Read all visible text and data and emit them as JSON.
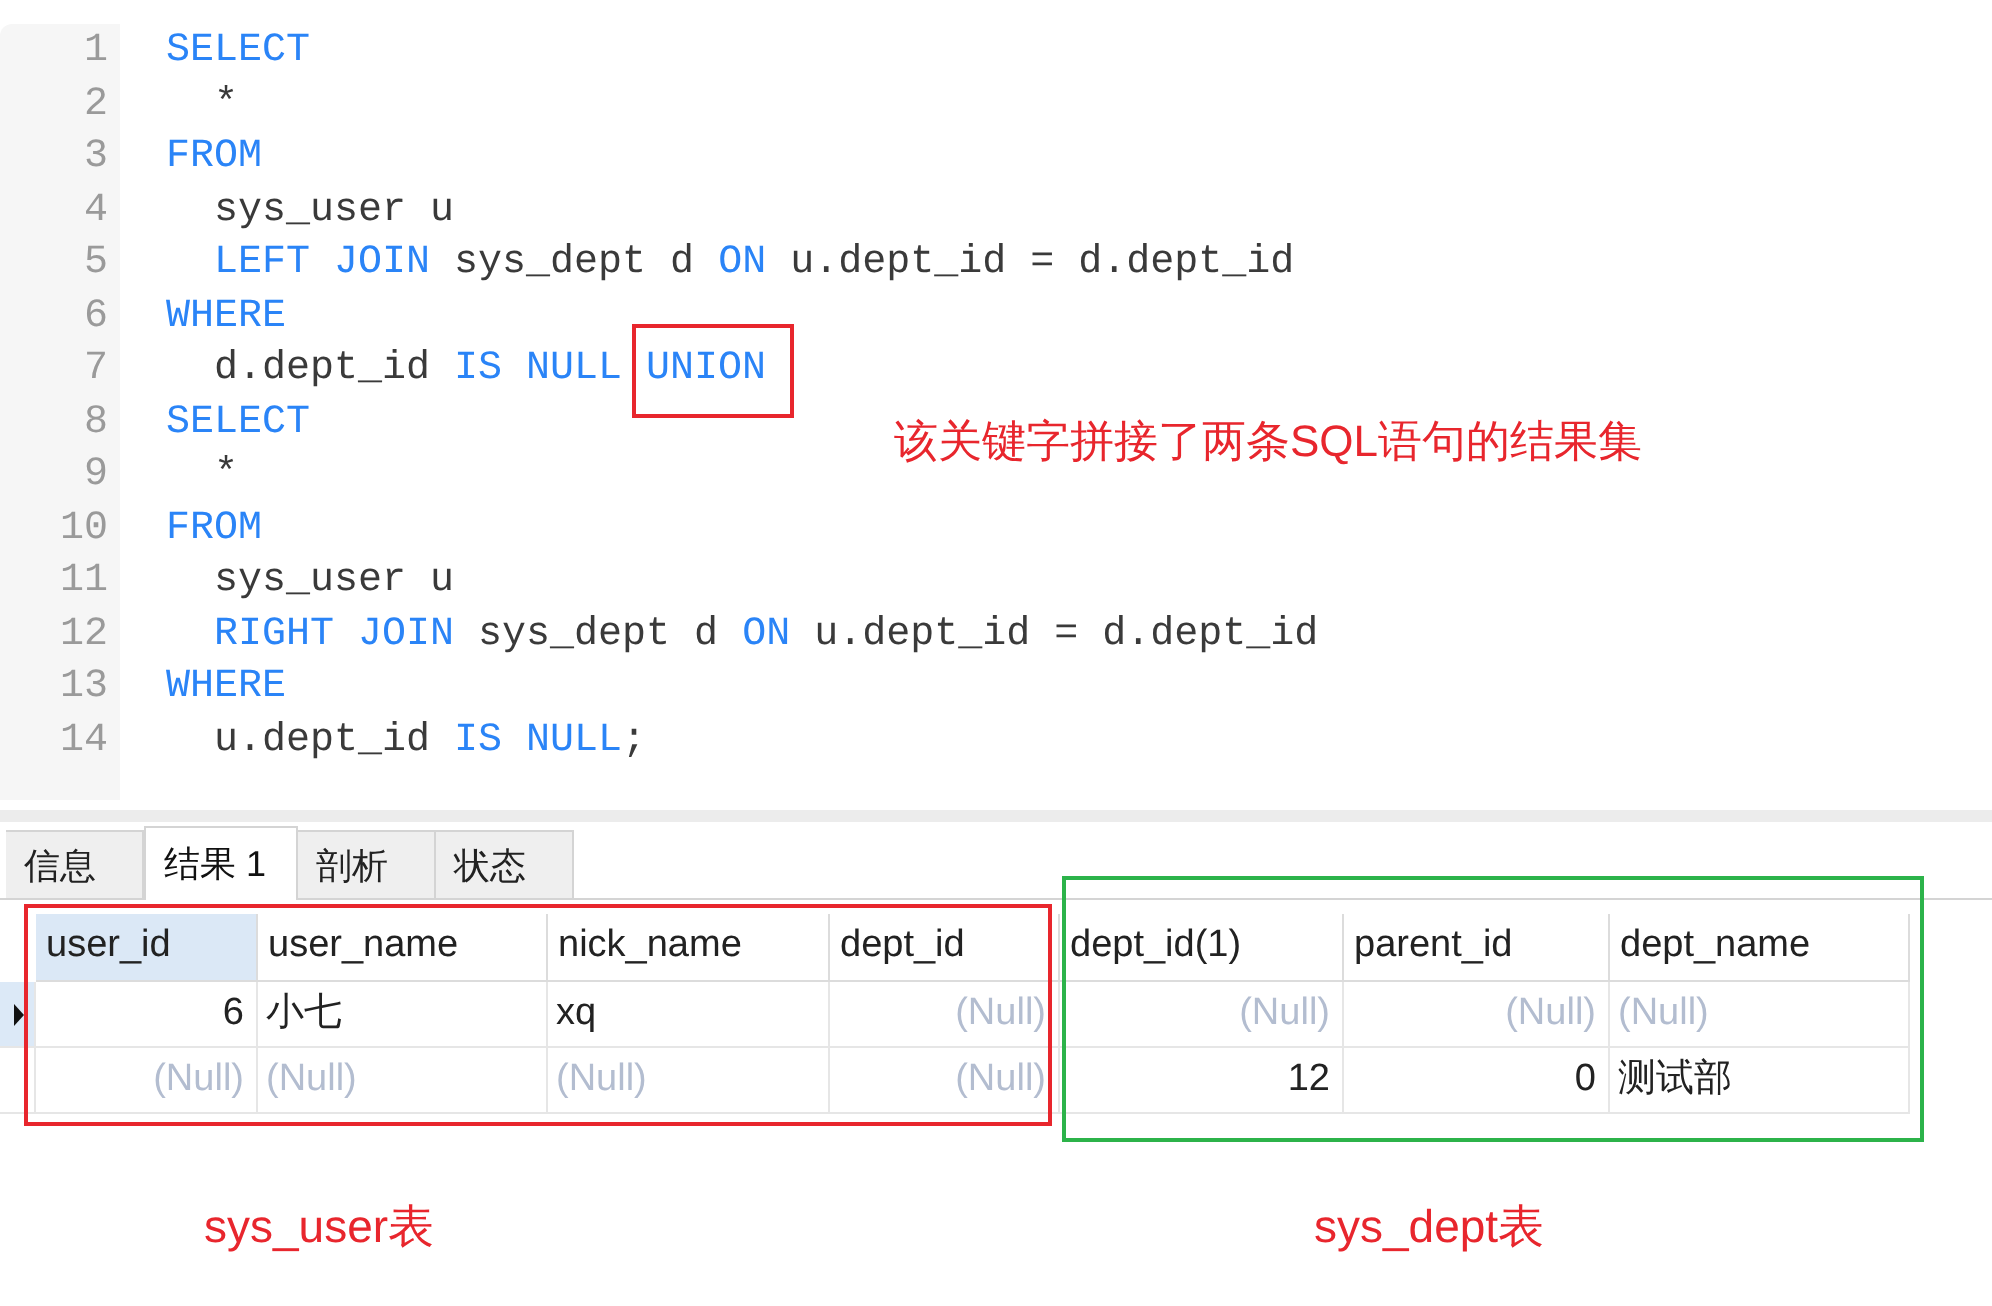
{
  "editor": {
    "lines": [
      {
        "number": "1",
        "tokens": [
          {
            "kind": "keyword",
            "text": "SELECT"
          }
        ]
      },
      {
        "number": "2",
        "tokens": [
          {
            "kind": "plain",
            "text": "  *"
          }
        ]
      },
      {
        "number": "3",
        "tokens": [
          {
            "kind": "keyword",
            "text": "FROM"
          }
        ]
      },
      {
        "number": "4",
        "tokens": [
          {
            "kind": "plain",
            "text": "  sys_user u"
          }
        ]
      },
      {
        "number": "5",
        "tokens": [
          {
            "kind": "keyword",
            "text": "  LEFT JOIN"
          },
          {
            "kind": "plain",
            "text": " sys_dept d "
          },
          {
            "kind": "keyword",
            "text": "ON"
          },
          {
            "kind": "plain",
            "text": " u.dept_id = d.dept_id"
          }
        ]
      },
      {
        "number": "6",
        "tokens": [
          {
            "kind": "keyword",
            "text": "WHERE"
          }
        ]
      },
      {
        "number": "7",
        "tokens": [
          {
            "kind": "plain",
            "text": "  d.dept_id "
          },
          {
            "kind": "keyword",
            "text": "IS NULL "
          },
          {
            "kind": "keyword",
            "text": "UNION",
            "boxed": true
          }
        ]
      },
      {
        "number": "8",
        "tokens": [
          {
            "kind": "keyword",
            "text": "SELECT"
          }
        ]
      },
      {
        "number": "9",
        "tokens": [
          {
            "kind": "plain",
            "text": "  *"
          }
        ]
      },
      {
        "number": "10",
        "tokens": [
          {
            "kind": "keyword",
            "text": "FROM"
          }
        ]
      },
      {
        "number": "11",
        "tokens": [
          {
            "kind": "plain",
            "text": "  sys_user u"
          }
        ]
      },
      {
        "number": "12",
        "tokens": [
          {
            "kind": "keyword",
            "text": "  RIGHT JOIN"
          },
          {
            "kind": "plain",
            "text": " sys_dept d "
          },
          {
            "kind": "keyword",
            "text": "ON"
          },
          {
            "kind": "plain",
            "text": " u.dept_id = d.dept_id"
          }
        ]
      },
      {
        "number": "13",
        "tokens": [
          {
            "kind": "keyword",
            "text": "WHERE"
          }
        ]
      },
      {
        "number": "14",
        "tokens": [
          {
            "kind": "plain",
            "text": "  u.dept_id "
          },
          {
            "kind": "keyword",
            "text": "IS NULL"
          },
          {
            "kind": "plain",
            "text": ";"
          }
        ]
      }
    ]
  },
  "note": "该关键字拼接了两条SQL语句的结果集",
  "tabs": [
    {
      "label": "信息",
      "selected": false
    },
    {
      "label": "结果 1",
      "selected": true
    },
    {
      "label": "剖析",
      "selected": false
    },
    {
      "label": "状态",
      "selected": false
    }
  ],
  "table": {
    "columns": [
      {
        "label": "user_id",
        "kind": "number",
        "selected": true
      },
      {
        "label": "user_name",
        "kind": "text",
        "selected": false
      },
      {
        "label": "nick_name",
        "kind": "text",
        "selected": false
      },
      {
        "label": "dept_id",
        "kind": "number",
        "selected": false
      },
      {
        "label": "dept_id(1)",
        "kind": "number",
        "selected": false
      },
      {
        "label": "parent_id",
        "kind": "number",
        "selected": false
      },
      {
        "label": "dept_name",
        "kind": "text",
        "selected": false
      }
    ],
    "rows": [
      {
        "selected": true,
        "cells": [
          {
            "text": "6",
            "is_null": false
          },
          {
            "text": "小七",
            "is_null": false
          },
          {
            "text": "xq",
            "is_null": false
          },
          {
            "text": "(Null)",
            "is_null": true
          },
          {
            "text": "(Null)",
            "is_null": true
          },
          {
            "text": "(Null)",
            "is_null": true
          },
          {
            "text": "(Null)",
            "is_null": true
          }
        ]
      },
      {
        "selected": false,
        "cells": [
          {
            "text": "(Null)",
            "is_null": true
          },
          {
            "text": "(Null)",
            "is_null": true
          },
          {
            "text": "(Null)",
            "is_null": true
          },
          {
            "text": "(Null)",
            "is_null": true
          },
          {
            "text": "12",
            "is_null": false
          },
          {
            "text": "0",
            "is_null": false
          },
          {
            "text": "测试部",
            "is_null": false
          }
        ]
      }
    ]
  },
  "frames": [
    {
      "color": "#e8262d",
      "label": "sys_user表"
    },
    {
      "color": "#2cb34a",
      "label": "sys_dept表"
    }
  ]
}
